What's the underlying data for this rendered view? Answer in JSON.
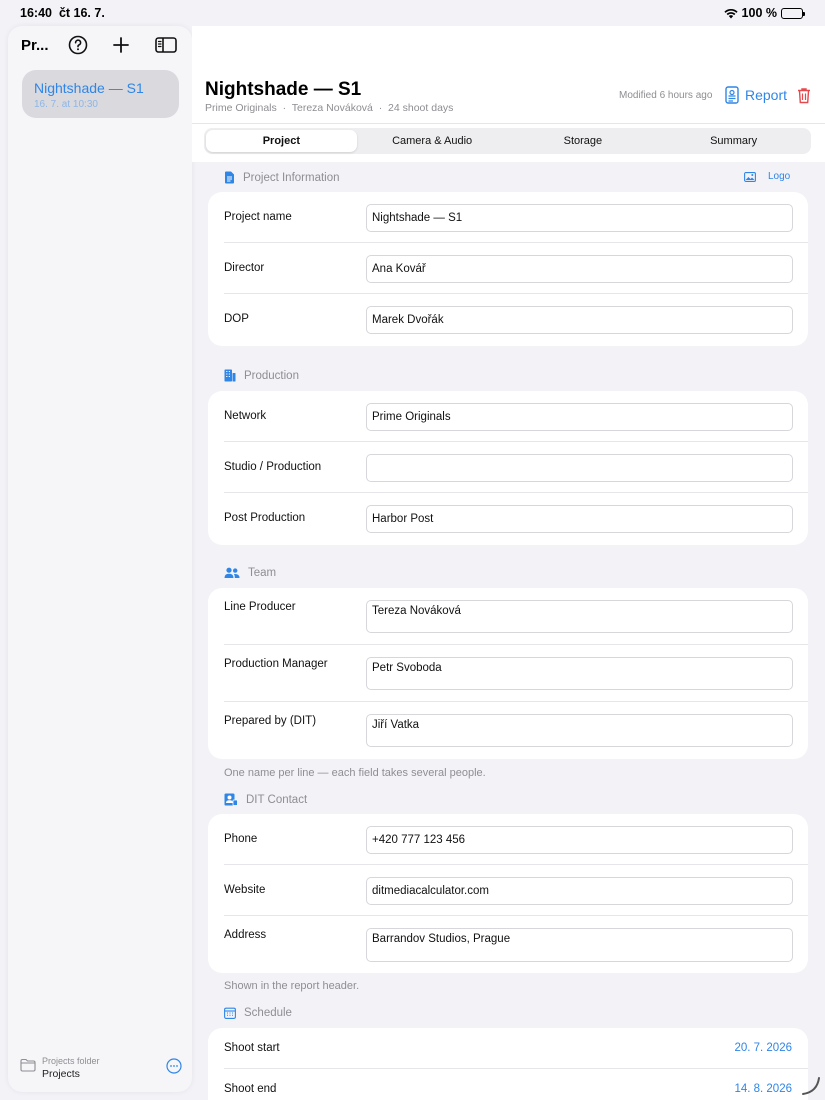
{
  "status_bar": {
    "time": "16:40",
    "date": "čt 16. 7.",
    "battery": "100 %"
  },
  "sidebar": {
    "title": "Pr...",
    "project": {
      "title": "Nightshade — S1",
      "date": "16. 7. at 10:30"
    },
    "folder_label": "Projects folder",
    "folder_name": "Projects"
  },
  "header": {
    "title": "Nightshade — S1",
    "subtitle": "Prime Originals  ·  Tereza Nováková  ·  24 shoot days",
    "modified": "Modified 6 hours ago",
    "report_label": "Report"
  },
  "tabs": [
    {
      "label": "Project",
      "active": true
    },
    {
      "label": "Camera & Audio",
      "active": false
    },
    {
      "label": "Storage",
      "active": false
    },
    {
      "label": "Summary",
      "active": false
    }
  ],
  "project_info": {
    "title": "Project Information",
    "logo_label": "Logo",
    "rows": [
      {
        "label": "Project name",
        "value": "Nightshade — S1"
      },
      {
        "label": "Director",
        "value": "Ana Kovář"
      },
      {
        "label": "DOP",
        "value": "Marek Dvořák"
      }
    ]
  },
  "production": {
    "title": "Production",
    "rows": [
      {
        "label": "Network",
        "value": "Prime Originals"
      },
      {
        "label": "Studio / Production",
        "value": ""
      },
      {
        "label": "Post Production",
        "value": "Harbor Post"
      }
    ]
  },
  "team": {
    "title": "Team",
    "rows": [
      {
        "label": "Line Producer",
        "value": "Tereza Nováková"
      },
      {
        "label": "Production Manager",
        "value": "Petr Svoboda"
      },
      {
        "label": "Prepared by (DIT)",
        "value": "Jiří Vatka"
      }
    ],
    "footnote": "One name per line — each field takes several people."
  },
  "dit_contact": {
    "title": "DIT Contact",
    "rows": [
      {
        "label": "Phone",
        "value": "+420 777 123 456"
      },
      {
        "label": "Website",
        "value": "ditmediacalculator.com"
      },
      {
        "label": "Address",
        "value": "Barrandov Studios, Prague"
      }
    ],
    "footnote": "Shown in the report header."
  },
  "schedule": {
    "title": "Schedule",
    "rows": [
      {
        "label": "Shoot start",
        "value": "20. 7. 2026"
      },
      {
        "label": "Shoot end",
        "value": "14. 8. 2026"
      }
    ]
  },
  "colors": {
    "accent": "#2f86e6",
    "destructive": "#e5484d",
    "secondary_text": "#8e8e93"
  }
}
